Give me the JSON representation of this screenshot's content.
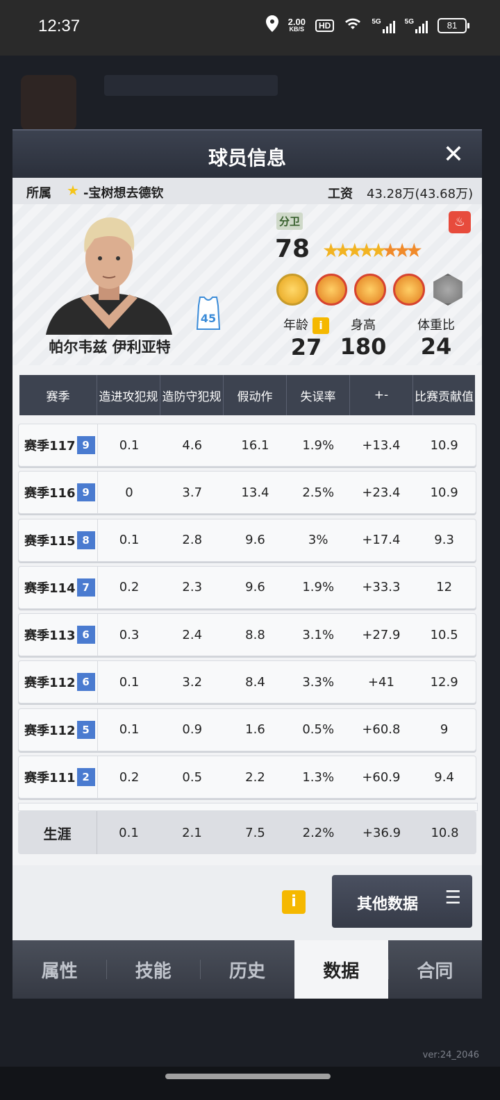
{
  "status_bar": {
    "time": "12:37",
    "net_speed": "2.00",
    "net_unit": "KB/S",
    "hd": "HD",
    "sig1": "5G",
    "sig2": "5G",
    "battery": "81"
  },
  "version": "ver:24_2046",
  "modal": {
    "title": "球员信息",
    "close": "✕",
    "team_label": "所属",
    "team_name": "-宝树想去德钦",
    "salary_label": "工资",
    "salary_value": "43.28万(43.68万)"
  },
  "player": {
    "name": "帕尔韦兹 伊利亚特",
    "jersey_number": "45",
    "position": "分卫",
    "overall": "78",
    "age_label": "年龄",
    "age": "27",
    "height_label": "身高",
    "height": "180",
    "weight_label": "体重比",
    "weight": "24",
    "info_icon": "i"
  },
  "table": {
    "headers": [
      "赛季",
      "造进攻犯规",
      "造防守犯规",
      "假动作",
      "失误率",
      "+-",
      "比赛贡献值"
    ],
    "rows": [
      {
        "season": "赛季117",
        "rank": "9",
        "c1": "0.1",
        "c2": "4.6",
        "c3": "16.1",
        "c4": "1.9%",
        "c5": "+13.4",
        "c6": "10.9"
      },
      {
        "season": "赛季116",
        "rank": "9",
        "c1": "0",
        "c2": "3.7",
        "c3": "13.4",
        "c4": "2.5%",
        "c5": "+23.4",
        "c6": "10.9"
      },
      {
        "season": "赛季115",
        "rank": "8",
        "c1": "0.1",
        "c2": "2.8",
        "c3": "9.6",
        "c4": "3%",
        "c5": "+17.4",
        "c6": "9.3"
      },
      {
        "season": "赛季114",
        "rank": "7",
        "c1": "0.2",
        "c2": "2.3",
        "c3": "9.6",
        "c4": "1.9%",
        "c5": "+33.3",
        "c6": "12"
      },
      {
        "season": "赛季113",
        "rank": "6",
        "c1": "0.3",
        "c2": "2.4",
        "c3": "8.8",
        "c4": "3.1%",
        "c5": "+27.9",
        "c6": "10.5"
      },
      {
        "season": "赛季112",
        "rank": "6",
        "c1": "0.1",
        "c2": "3.2",
        "c3": "8.4",
        "c4": "3.3%",
        "c5": "+41",
        "c6": "12.9"
      },
      {
        "season": "赛季112",
        "rank": "5",
        "c1": "0.1",
        "c2": "0.9",
        "c3": "1.6",
        "c4": "0.5%",
        "c5": "+60.8",
        "c6": "9"
      },
      {
        "season": "赛季111",
        "rank": "2",
        "c1": "0.2",
        "c2": "0.5",
        "c3": "2.2",
        "c4": "1.3%",
        "c5": "+60.9",
        "c6": "9.4"
      }
    ],
    "career": {
      "season": "生涯",
      "c1": "0.1",
      "c2": "2.1",
      "c3": "7.5",
      "c4": "2.2%",
      "c5": "+36.9",
      "c6": "10.8"
    }
  },
  "footer": {
    "info": "i",
    "other_data": "其他数据",
    "menu_glyph": "☰"
  },
  "tabs": [
    "属性",
    "技能",
    "历史",
    "数据",
    "合同"
  ]
}
